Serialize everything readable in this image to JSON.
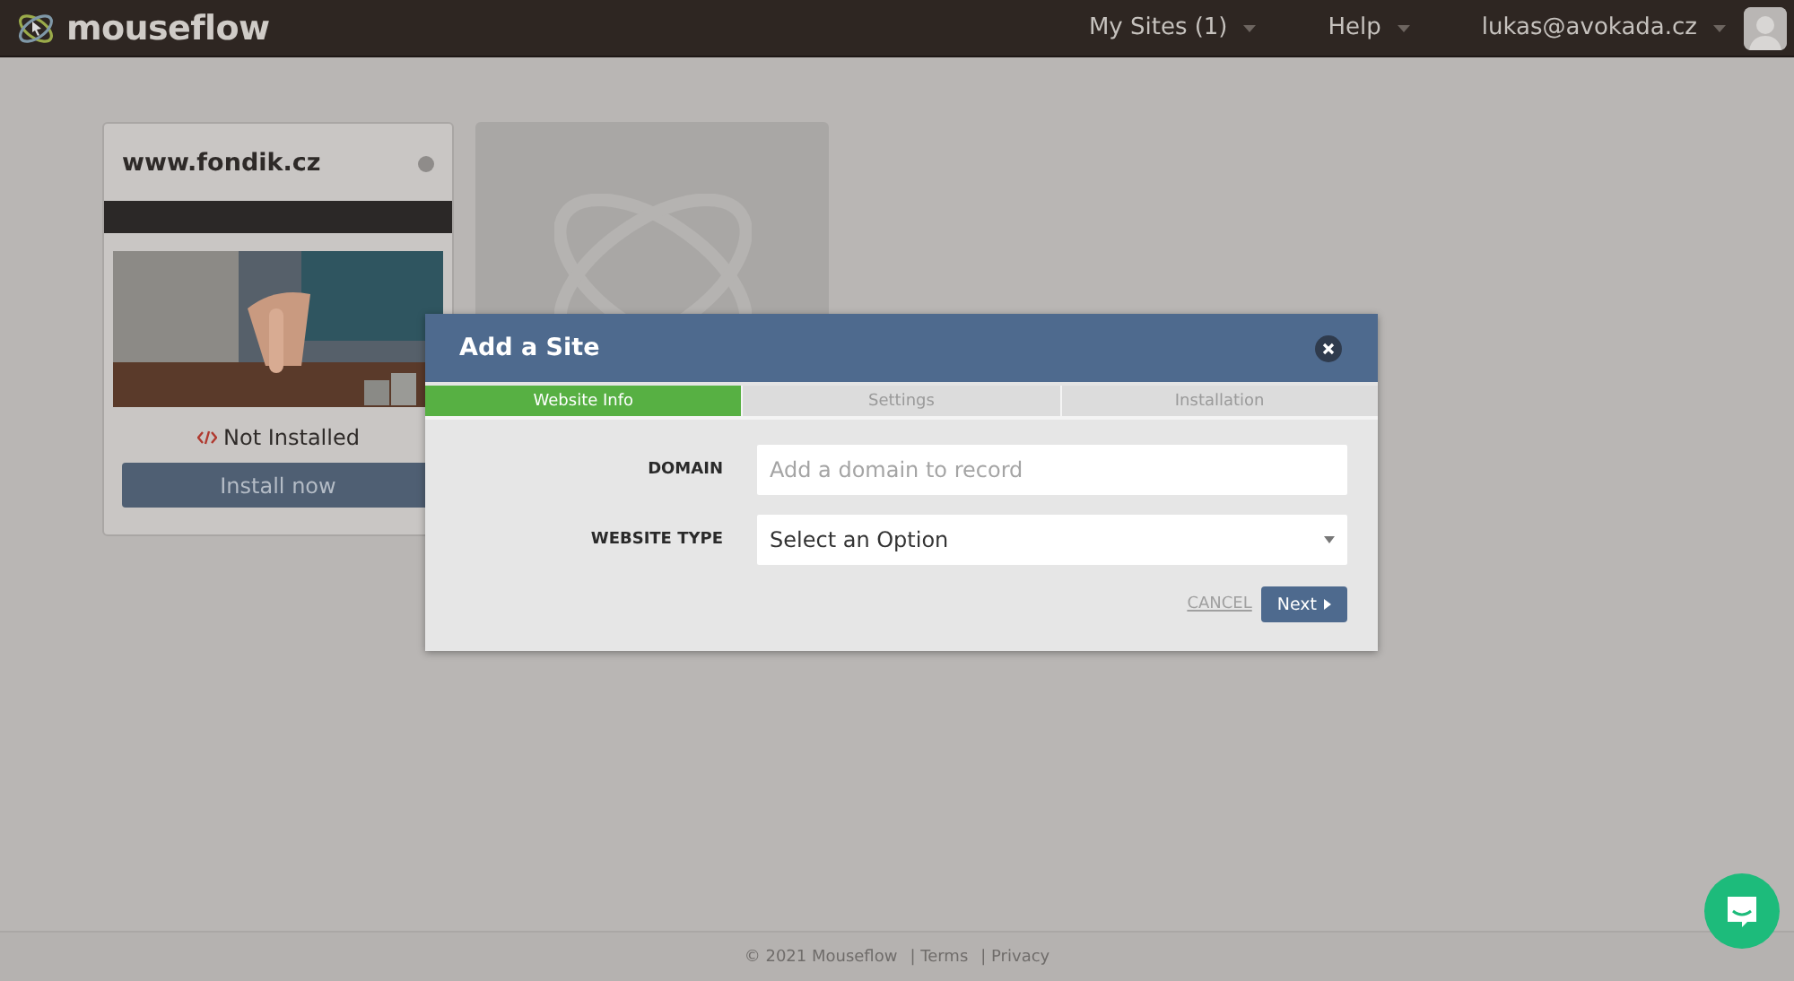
{
  "header": {
    "logo": "mouseflow",
    "nav": [
      {
        "label": "My Sites (1)"
      },
      {
        "label": "Help"
      },
      {
        "label": "lukas@avokada.cz"
      }
    ]
  },
  "sites": [
    {
      "kind": "site",
      "domain": "www.fondik.cz",
      "status": "Not Installed",
      "button": "Install now"
    },
    {
      "kind": "placeholder"
    }
  ],
  "modal": {
    "title": "Add a Site",
    "tabs": [
      {
        "label": "Website Info",
        "selected": true
      },
      {
        "label": "Settings",
        "selected": false
      },
      {
        "label": "Installation",
        "selected": false
      }
    ],
    "fields": [
      {
        "kind": "text",
        "label": "DOMAIN",
        "placeholder": "Add a domain to record"
      },
      {
        "kind": "select",
        "label": "WEBSITE TYPE",
        "value": "Select an Option"
      }
    ],
    "cancel": "CANCEL",
    "next": "Next"
  },
  "footer": [
    "© 2021 Mouseflow",
    "| Terms",
    "| Privacy"
  ]
}
